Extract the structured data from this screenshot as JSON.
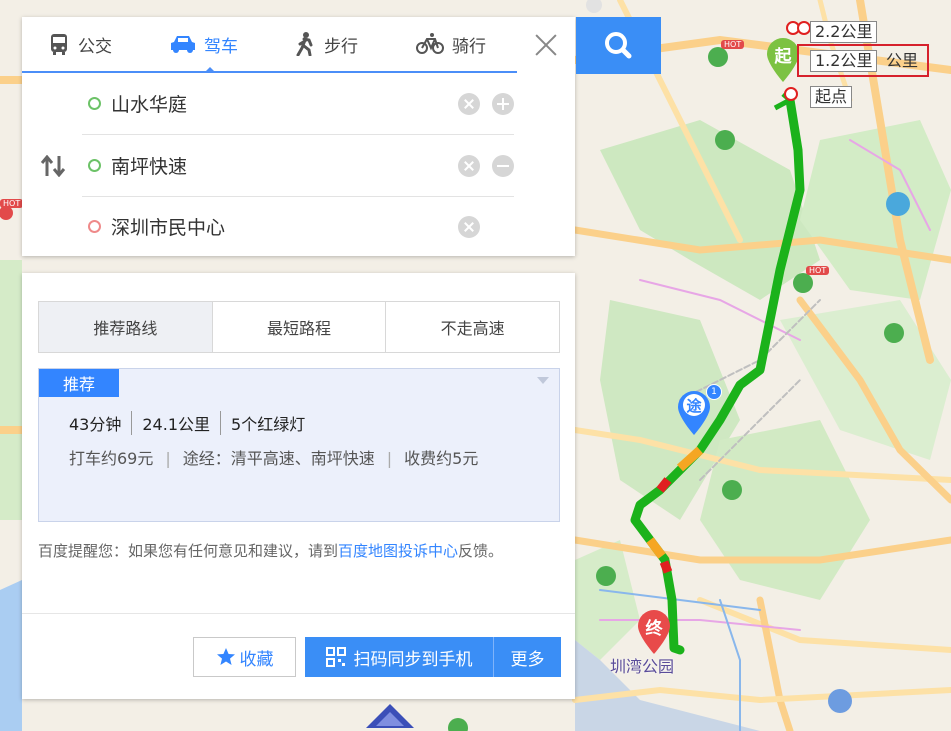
{
  "modes": [
    {
      "label": "公交",
      "icon": "bus-icon"
    },
    {
      "label": "驾车",
      "icon": "car-icon"
    },
    {
      "label": "步行",
      "icon": "walk-icon"
    },
    {
      "label": "骑行",
      "icon": "bike-icon"
    }
  ],
  "active_mode": "驾车",
  "waypoints": {
    "start": "山水华庭",
    "via": "南坪快速",
    "end": "深圳市民中心"
  },
  "route_tabs": [
    "推荐路线",
    "最短路程",
    "不走高速"
  ],
  "recommended": {
    "tag": "推荐",
    "duration": "43分钟",
    "distance": "24.1公里",
    "lights": "5个红绿灯",
    "taxi": "打车约69元",
    "via": "途经：清平高速、南坪快速",
    "toll": "收费约5元"
  },
  "notice": {
    "prefix": "百度提醒您：如果您有任何意见和建议，请到",
    "link": "百度地图投诉中心",
    "suffix": "反馈。"
  },
  "buttons": {
    "favorite": "收藏",
    "sync": "扫码同步到手机",
    "more": "更多"
  },
  "map": {
    "start_marker": "起",
    "end_marker": "终",
    "via_marker": "途",
    "via_badge": "1",
    "label_2_2": "2.2公里",
    "label_1_2": "1.2公里",
    "label_1_2_suffix": "公里",
    "label_start": "起点",
    "place_label": "圳湾公园",
    "hot_badge": "HOT",
    "colors": {
      "route": "#1bb21b",
      "slow": "#f5a623",
      "jam": "#e02020",
      "accent": "#3385ff"
    }
  }
}
